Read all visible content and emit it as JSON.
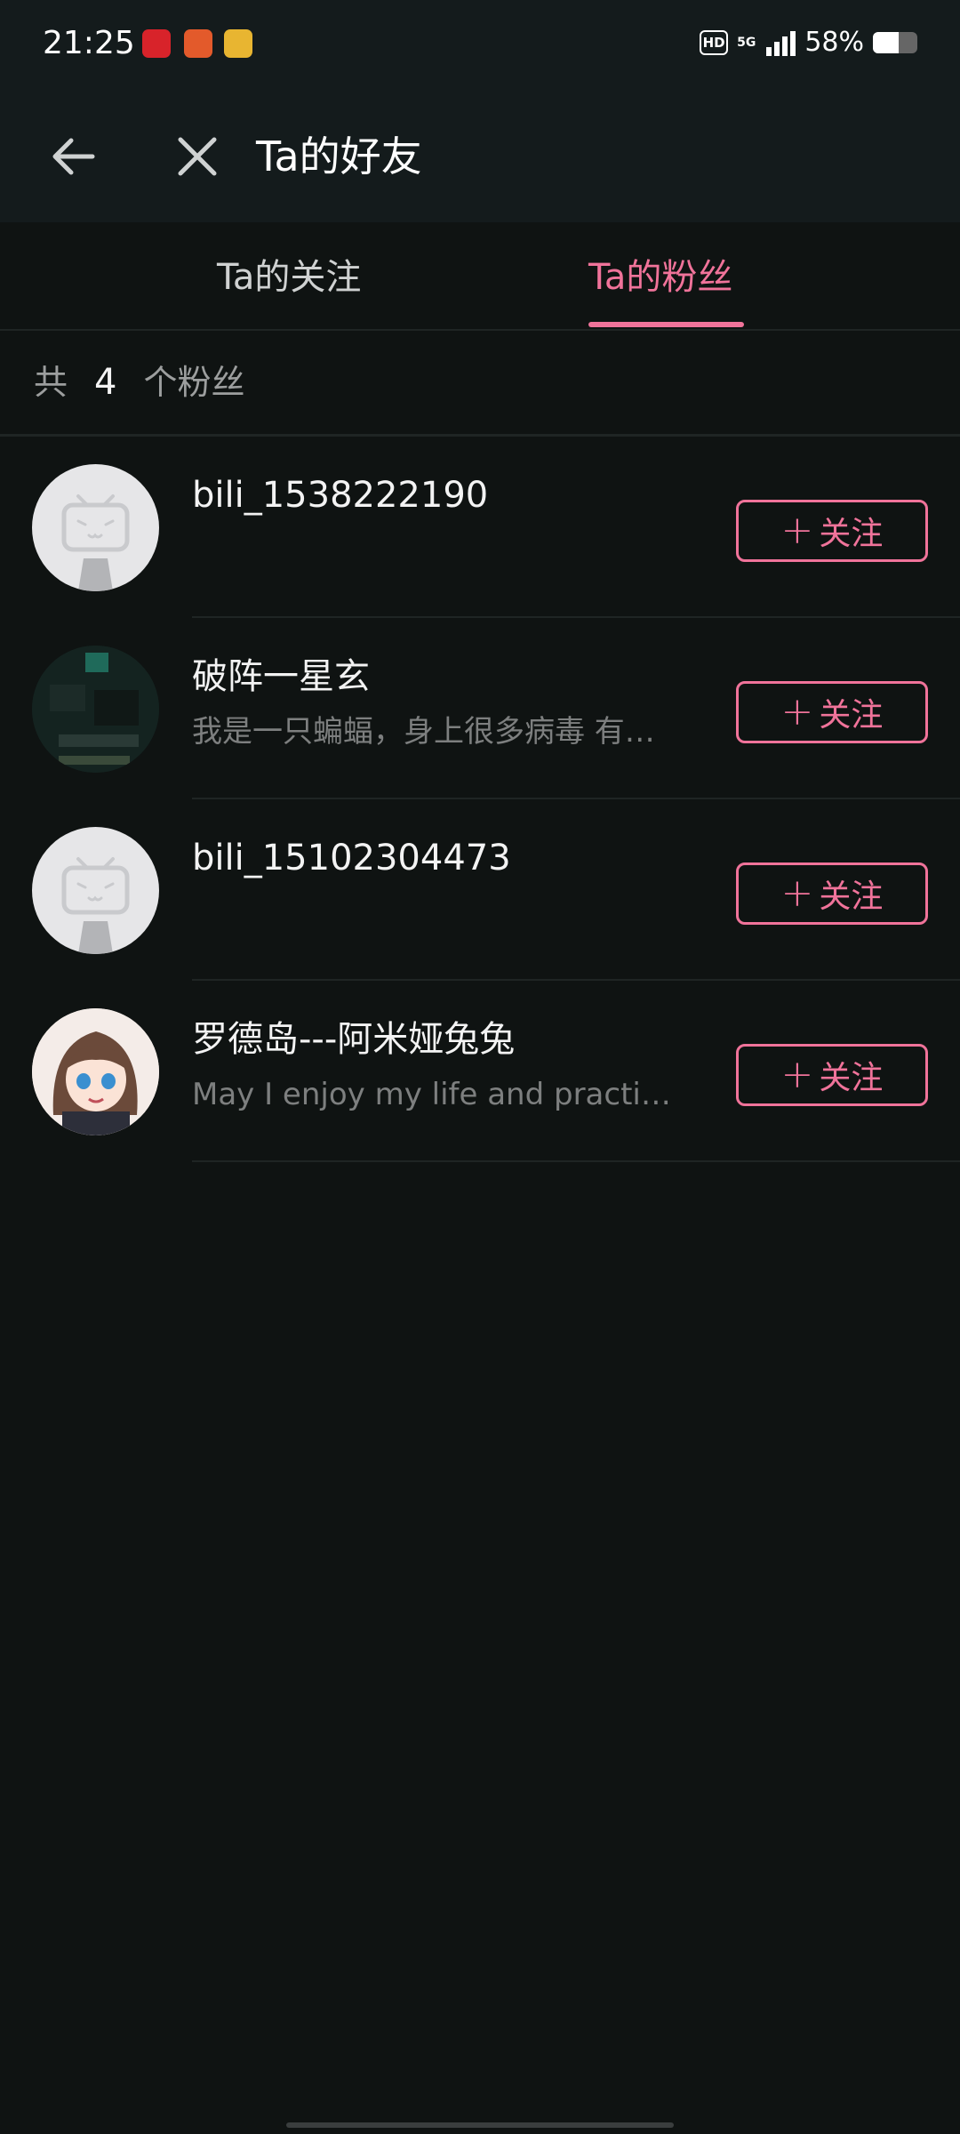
{
  "status_bar": {
    "time": "21:25",
    "hd_label": "HD",
    "network": "5G",
    "battery_percent": "58%",
    "battery_level": 0.58,
    "app_icons": [
      "netease-music-icon",
      "game-app-icon",
      "comic-app-icon"
    ]
  },
  "header": {
    "title": "Ta的好友"
  },
  "tabs": [
    {
      "label": "Ta的关注",
      "active": false
    },
    {
      "label": "Ta的粉丝",
      "active": true
    }
  ],
  "summary": {
    "prefix": "共",
    "count": "4",
    "suffix": "个粉丝"
  },
  "fans": [
    {
      "name": "bili_1538222190",
      "sign": "",
      "avatar": "default-tv-avatar-icon",
      "button": "关注"
    },
    {
      "name": "破阵一星玄",
      "sign": "我是一只蝙蝠，身上很多病毒 有…",
      "avatar": "game-scene-avatar",
      "button": "关注"
    },
    {
      "name": "bili_15102304473",
      "sign": "",
      "avatar": "default-tv-avatar-icon",
      "button": "关注"
    },
    {
      "name": "罗德岛---阿米娅兔兔",
      "sign": "May I enjoy my life and practi…",
      "avatar": "anime-girl-avatar",
      "button": "关注"
    }
  ],
  "colors": {
    "accent": "#f0739a",
    "background": "#0f1312",
    "header_bg": "#141b1c"
  }
}
